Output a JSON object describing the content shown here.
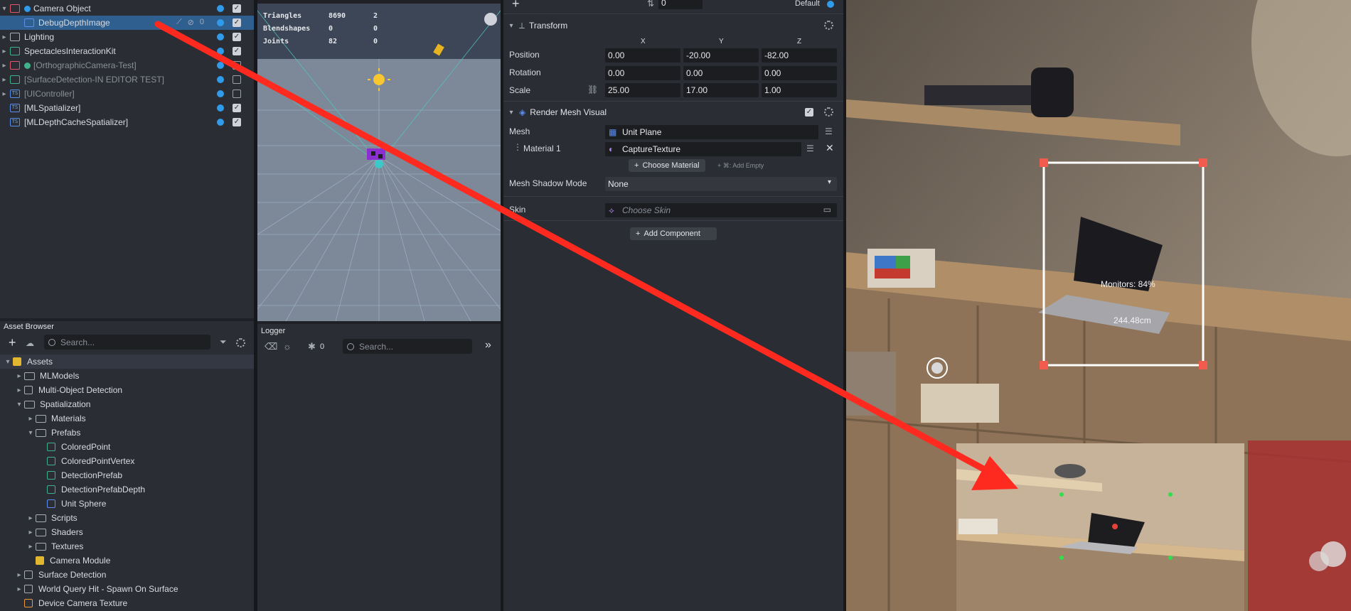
{
  "hierarchy": {
    "items": [
      {
        "label": "Camera Object",
        "expanded": true
      },
      {
        "label": "DebugDepthImage",
        "selected": true,
        "count": "0"
      },
      {
        "label": "Lighting"
      },
      {
        "label": "SpectaclesInteractionKit"
      },
      {
        "label": "[OrthographicCamera-Test]",
        "disabled": true
      },
      {
        "label": "[SurfaceDetection-IN EDITOR TEST]",
        "disabled": true
      },
      {
        "label": "[UIController]",
        "disabled": true
      },
      {
        "label": "[MLSpatializer]"
      },
      {
        "label": "[MLDepthCacheSpatializer]"
      }
    ]
  },
  "scene_stats": {
    "rows": [
      {
        "label": "Triangles",
        "value": "8690",
        "extra": "2"
      },
      {
        "label": "Blendshapes",
        "value": "0",
        "extra": "0"
      },
      {
        "label": "Joints",
        "value": "82",
        "extra": "0"
      }
    ]
  },
  "asset_browser": {
    "title": "Asset Browser",
    "search_placeholder": "Search...",
    "items": [
      {
        "label": "Assets"
      },
      {
        "label": "MLModels"
      },
      {
        "label": "Multi-Object Detection"
      },
      {
        "label": "Spatialization"
      },
      {
        "label": "Materials"
      },
      {
        "label": "Prefabs"
      },
      {
        "label": "ColoredPoint"
      },
      {
        "label": "ColoredPointVertex"
      },
      {
        "label": "DetectionPrefab"
      },
      {
        "label": "DetectionPrefabDepth"
      },
      {
        "label": "Unit Sphere"
      },
      {
        "label": "Scripts"
      },
      {
        "label": "Shaders"
      },
      {
        "label": "Textures"
      },
      {
        "label": "Camera Module"
      },
      {
        "label": "Surface Detection"
      },
      {
        "label": "World Query Hit - Spawn On Surface"
      },
      {
        "label": "Device Camera Texture"
      }
    ]
  },
  "logger": {
    "title": "Logger",
    "count": "0",
    "search_placeholder": "Search..."
  },
  "inspector": {
    "top_value": "0",
    "layer": "Default",
    "transform": {
      "title": "Transform",
      "axes": [
        "X",
        "Y",
        "Z"
      ],
      "rows": [
        {
          "label": "Position",
          "values": [
            "0.00",
            "-20.00",
            "-82.00"
          ]
        },
        {
          "label": "Rotation",
          "values": [
            "0.00",
            "0.00",
            "0.00"
          ]
        },
        {
          "label": "Scale",
          "values": [
            "25.00",
            "17.00",
            "1.00"
          ]
        }
      ]
    },
    "render_mesh": {
      "title": "Render Mesh Visual",
      "mesh_label": "Mesh",
      "mesh_value": "Unit Plane",
      "material_label": "Material 1",
      "material_value": "CaptureTexture",
      "choose_material": "Choose Material",
      "add_empty_hint": "+ ⌘: Add Empty",
      "shadow_label": "Mesh Shadow Mode",
      "shadow_value": "None",
      "skin_label": "Skin",
      "skin_placeholder": "Choose Skin"
    },
    "add_component": "Add Component"
  },
  "preview": {
    "detection_label": "Monitors: 84%",
    "distance_label": "244.48cm"
  },
  "colors": {
    "accent_blue": "#2f9bea",
    "selection": "#2f5f8e",
    "annotation_red": "#ff2a1f",
    "handle_red": "#f25c4e"
  }
}
